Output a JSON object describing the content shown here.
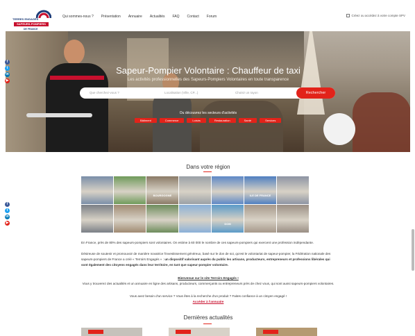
{
  "header": {
    "logo": {
      "line1": "TERRES ENGAGÉS",
      "line2": "SAPEURS-POMPIERS",
      "line3": "DE FRANCE"
    },
    "nav": [
      "Qui sommes-nous ?",
      "Présentation",
      "Annuaire",
      "Actualités",
      "FAQ",
      "Contact",
      "Forum"
    ],
    "account": "Créez ou accédez à votre compte SPV"
  },
  "hero": {
    "title": "Sapeur-Pompier Volontaire : Chauffeur de taxi",
    "subtitle": "Les activités professionnelles des Sapeurs-Pompiers Volontaires en toute transparence",
    "search_what_placeholder": "Que cherchez-vous ?",
    "search_where_placeholder": "Localisation (Ville, CP...)",
    "search_radius": "Choisir un rayon",
    "search_button": "Rechercher",
    "or_text": "Ou découvrez les secteurs d'activités",
    "categories": [
      "Bâtiment",
      "Commerce",
      "Loisirs",
      "Restauration",
      "Santé",
      "Services"
    ]
  },
  "social": {
    "colors": {
      "facebook": "#3b5998",
      "twitter": "#1da1f2",
      "linkedin": "#0077b5",
      "youtube": "#e2231a"
    }
  },
  "region": {
    "title": "Dans votre région",
    "tiles": [
      {
        "label": "",
        "color": "#7a8ea8"
      },
      {
        "label": "",
        "color": "#6f9a5a"
      },
      {
        "label": "BOURGOGNE",
        "color": "#8a7a66"
      },
      {
        "label": "",
        "color": "#9aa0a6"
      },
      {
        "label": "",
        "color": "#5d88c6"
      },
      {
        "label": "ILE DE FRANCE",
        "color": "#4f7fc0"
      },
      {
        "label": "",
        "color": "#8d94a3"
      },
      {
        "label": "",
        "color": "#7a7f86"
      },
      {
        "label": "",
        "color": "#a08a72"
      },
      {
        "label": "",
        "color": "#6d8c5c"
      },
      {
        "label": "",
        "color": "#8ab0d8"
      },
      {
        "label": "DOM",
        "color": "#5a9ac8"
      },
      {
        "label": "",
        "color": "#a6988a"
      },
      {
        "label": "",
        "color": "#9a8e84"
      }
    ]
  },
  "body": {
    "para1": "En France, près de 80% des sapeurs-pompiers sont volontaires. On estime à 60 000 le nombre de ces sapeurs-pompiers qui exercent une profession indépendante.",
    "para2a": "Désireuse de soutenir et promouvoir de manière novatrice l'investissement généreux, basé sur le don de soi, qu'est le volontariat de sapeur-pompier, la Fédération nationale des sapeurs-pompiers de France a créé « Terroirs Engagés » : ",
    "para2b": "un dispositif valorisant auprès du public les artisans, producteurs, entrepreneurs et professions libérales qui sont également des citoyens engagés dans leur territoire, en tant que sapeur-pompier volontaire.",
    "welcome": "Bienvenue sur le site Terroirs Engagés !",
    "para3": "Vous y trouverez des actualités et un annuaire en ligne des artisans, producteurs, commerçants ou entrepreneurs près de chez vous, qui sont aussi sapeurs-pompiers volontaires.",
    "para4": "Vous avez besoin d'un service ? Vous êtes à la recherche d'un produit ? Faites confiance à un citoyen engagé !",
    "directory_link": "Accéder à l'annuaire"
  },
  "news": {
    "title": "Dernières actualités"
  }
}
